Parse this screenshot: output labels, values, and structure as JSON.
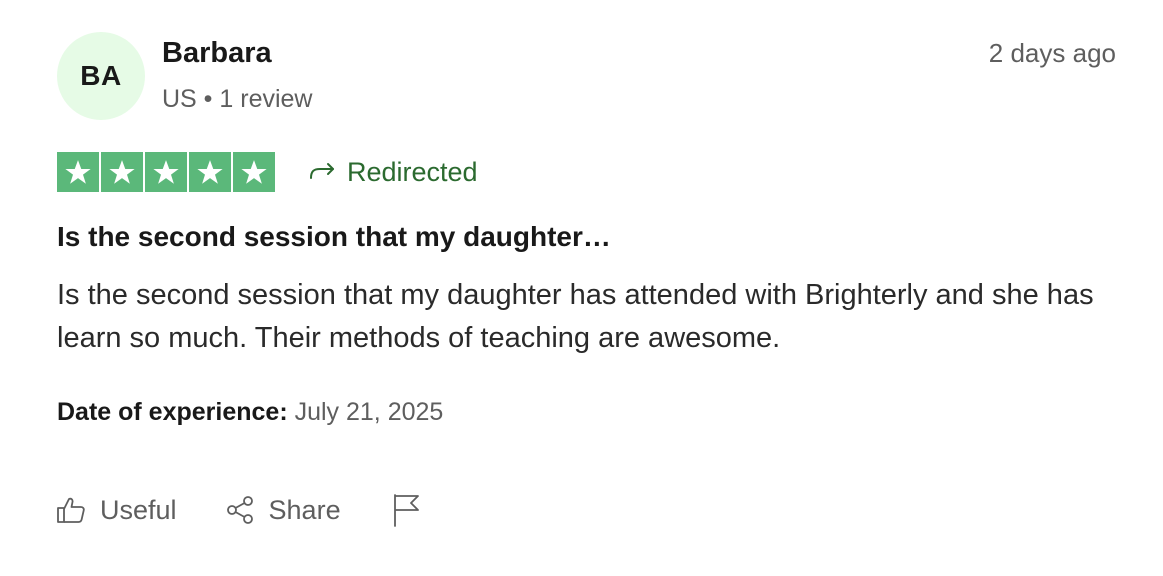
{
  "review": {
    "avatar_initials": "BA",
    "reviewer_name": "Barbara",
    "reviewer_country": "US",
    "meta_separator": " • ",
    "reviewer_review_count": "1 review",
    "posted_ago": "2 days ago",
    "rating": 5,
    "rating_max": 5,
    "redirected_label": "Redirected",
    "title": "Is the second session that my daughter…",
    "body": "Is the second session that my daughter has attended with Brighterly and she has learn so much. Their methods of teaching are awesome.",
    "experience_label": "Date of experience:",
    "experience_date": "July 21, 2025"
  },
  "actions": {
    "useful_label": "Useful",
    "share_label": "Share"
  },
  "colors": {
    "star_background": "#5bb87a",
    "avatar_background": "#e6fbe6",
    "redirected_text": "#2b6a2f",
    "muted_text": "#5e5e5e"
  },
  "icons": {
    "star": "star-icon",
    "redirected": "redirect-arrow-icon",
    "useful": "thumbs-up-icon",
    "share": "share-icon",
    "report": "flag-icon"
  }
}
